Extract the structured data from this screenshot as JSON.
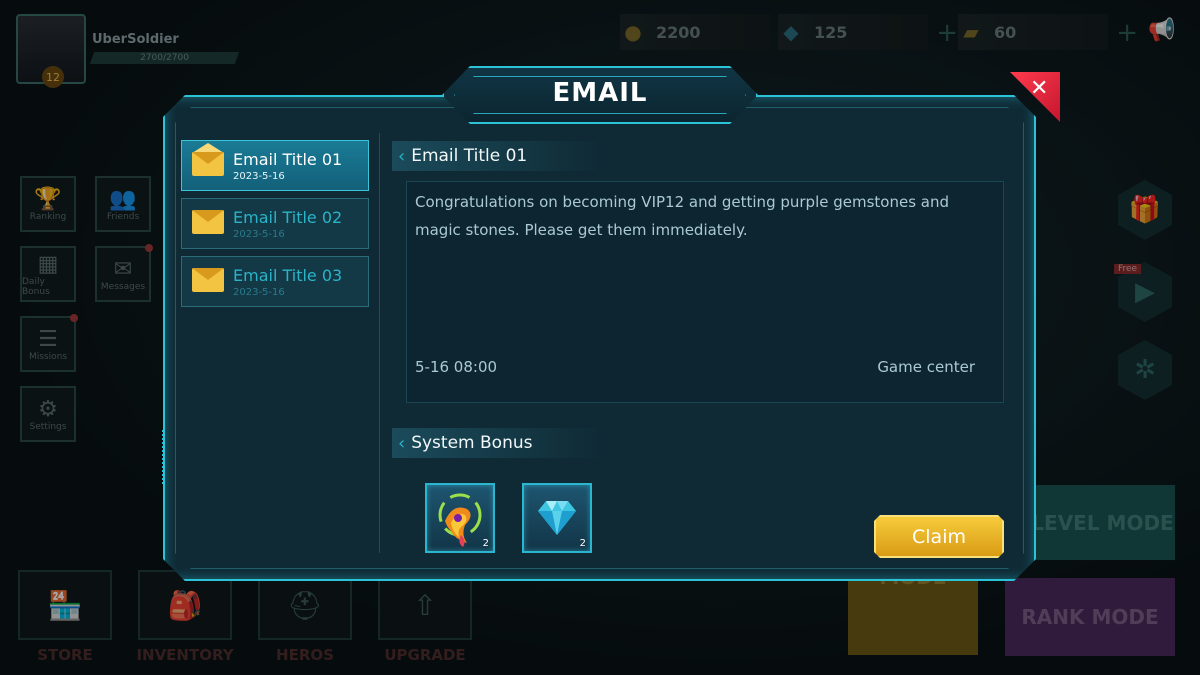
{
  "player": {
    "name": "UberSoldier",
    "exp": "2700/2700",
    "level": "12"
  },
  "currencies": [
    {
      "name": "coin-icon",
      "value": "2200",
      "color": "#d4a017"
    },
    {
      "name": "diamond-icon",
      "value": "125",
      "color": "#3ec6e0"
    },
    {
      "name": "ticket-icon",
      "value": "60",
      "color": "#d49a1a"
    }
  ],
  "side_menu": [
    {
      "label": "Ranking"
    },
    {
      "label": "Friends"
    },
    {
      "label": "Daily Bonus"
    },
    {
      "label": "Messages"
    },
    {
      "label": "Missions"
    },
    {
      "label": "Settings"
    }
  ],
  "right_menu": {
    "free_badge": "Free"
  },
  "bottom_menu": [
    "STORE",
    "INVENTORY",
    "HEROS",
    "UPGRADE"
  ],
  "modes": {
    "level": "LEVEL MODE",
    "mode": "MODE",
    "rank": "RANK MODE"
  },
  "modal": {
    "title": "EMAIL",
    "emails": [
      {
        "title": "Email Title 01",
        "date": "2023-5-16",
        "active": true
      },
      {
        "title": "Email Title 02",
        "date": "2023-5-16",
        "active": false
      },
      {
        "title": "Email Title 03",
        "date": "2023-5-16",
        "active": false
      }
    ],
    "detail": {
      "title": "Email Title 01",
      "body": "Congratulations on becoming VIP12 and getting purple gemstones and magic stones. Please get them immediately.",
      "time": "5-16  08:00",
      "sender": "Game center"
    },
    "bonus_heading": "System  Bonus",
    "rewards": [
      {
        "name": "magic-stone-icon",
        "count": "2"
      },
      {
        "name": "diamond-icon",
        "count": "2"
      }
    ],
    "claim_label": "Claim"
  }
}
